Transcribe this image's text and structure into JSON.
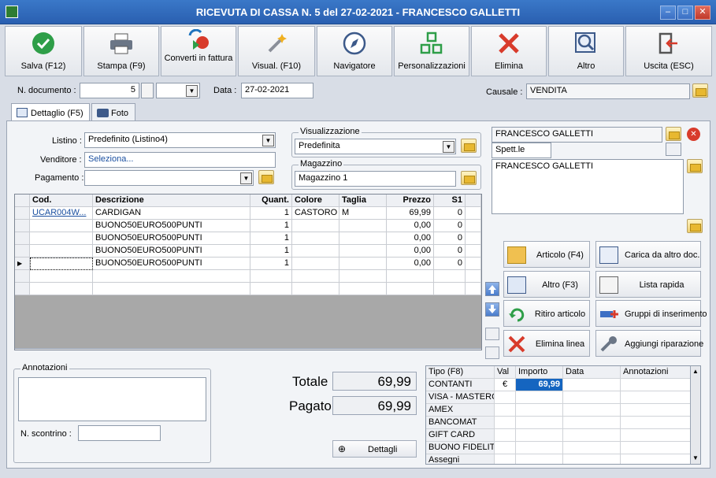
{
  "window": {
    "title": "RICEVUTA DI CASSA N. 5 del 27-02-2021 - FRANCESCO GALLETTI"
  },
  "toolbar": [
    {
      "label": "Salva (F12)",
      "icon": "check-icon"
    },
    {
      "label": "Stampa (F9)",
      "icon": "printer-icon"
    },
    {
      "label": "Converti in fattura",
      "icon": "convert-icon"
    },
    {
      "label": "Visual. (F10)",
      "icon": "wand-icon"
    },
    {
      "label": "Navigatore",
      "icon": "compass-icon"
    },
    {
      "label": "Personalizzazioni",
      "icon": "grid-icon"
    },
    {
      "label": "Elimina",
      "icon": "x-icon"
    },
    {
      "label": "Altro",
      "icon": "magnifier-icon"
    },
    {
      "label": "Uscita (ESC)",
      "icon": "exit-icon"
    }
  ],
  "header": {
    "ndoc_label": "N. documento :",
    "ndoc_value": "5",
    "data_label": "Data :",
    "data_value": "27-02-2021",
    "causale_label": "Causale :",
    "causale_value": "VENDITA"
  },
  "tabs": [
    {
      "label": "Dettaglio (F5)"
    },
    {
      "label": "Foto"
    }
  ],
  "form": {
    "listino_label": "Listino :",
    "listino_value": "Predefinito (Listino4)",
    "venditore_label": "Venditore :",
    "venditore_value": "Seleziona...",
    "pagamento_label": "Pagamento :",
    "pagamento_value": "",
    "visualizzazione_legend": "Visualizzazione",
    "visualizzazione_value": "Predefinita",
    "magazzino_legend": "Magazzino",
    "magazzino_value": "Magazzino 1"
  },
  "customer": {
    "name": "FRANCESCO GALLETTI",
    "salutation": "Spett.le",
    "address": "FRANCESCO GALLETTI"
  },
  "grid": {
    "columns": [
      "Cod.",
      "Descrizione",
      "Quant.",
      "Colore",
      "Taglia",
      "Prezzo",
      "S1"
    ],
    "rows": [
      [
        "UCAR004W...",
        "CARDIGAN",
        "1",
        "CASTORO",
        "M",
        "69,99",
        "0"
      ],
      [
        "",
        "BUONO50EURO500PUNTI",
        "1",
        "",
        "",
        "0,00",
        "0"
      ],
      [
        "",
        "BUONO50EURO500PUNTI",
        "1",
        "",
        "",
        "0,00",
        "0"
      ],
      [
        "",
        "BUONO50EURO500PUNTI",
        "1",
        "",
        "",
        "0,00",
        "0"
      ],
      [
        "",
        "BUONO50EURO500PUNTI",
        "1",
        "",
        "",
        "0,00",
        "0"
      ]
    ]
  },
  "side_buttons": [
    {
      "label": "Articolo (F4)"
    },
    {
      "label": "Carica da altro doc."
    },
    {
      "label": "Altro (F3)"
    },
    {
      "label": "Lista rapida"
    },
    {
      "label": "Ritiro articolo"
    },
    {
      "label": "Gruppi di inserimento"
    },
    {
      "label": "Elimina linea"
    },
    {
      "label": "Aggiungi riparazione"
    }
  ],
  "notes": {
    "legend": "Annotazioni",
    "scontrino_label": "N. scontrino :"
  },
  "totals": {
    "totale_label": "Totale",
    "totale_value": "69,99",
    "pagato_label": "Pagato",
    "pagato_value": "69,99",
    "dettagli_label": "Dettagli"
  },
  "payments": {
    "columns": [
      "Tipo (F8)",
      "Val",
      "Importo",
      "Data",
      "Annotazioni"
    ],
    "rows": [
      [
        "CONTANTI",
        "€",
        "69,99",
        "",
        ""
      ],
      [
        "VISA - MASTERC...",
        "",
        "",
        "",
        ""
      ],
      [
        "AMEX",
        "",
        "",
        "",
        ""
      ],
      [
        "BANCOMAT",
        "",
        "",
        "",
        ""
      ],
      [
        "GIFT CARD",
        "",
        "",
        "",
        ""
      ],
      [
        "BUONO FIDELITY",
        "",
        "",
        "",
        ""
      ],
      [
        "Assegni",
        "",
        "",
        "",
        ""
      ]
    ]
  },
  "colors": {
    "accent": "#2a5fb0",
    "selected": "#1565c0"
  }
}
